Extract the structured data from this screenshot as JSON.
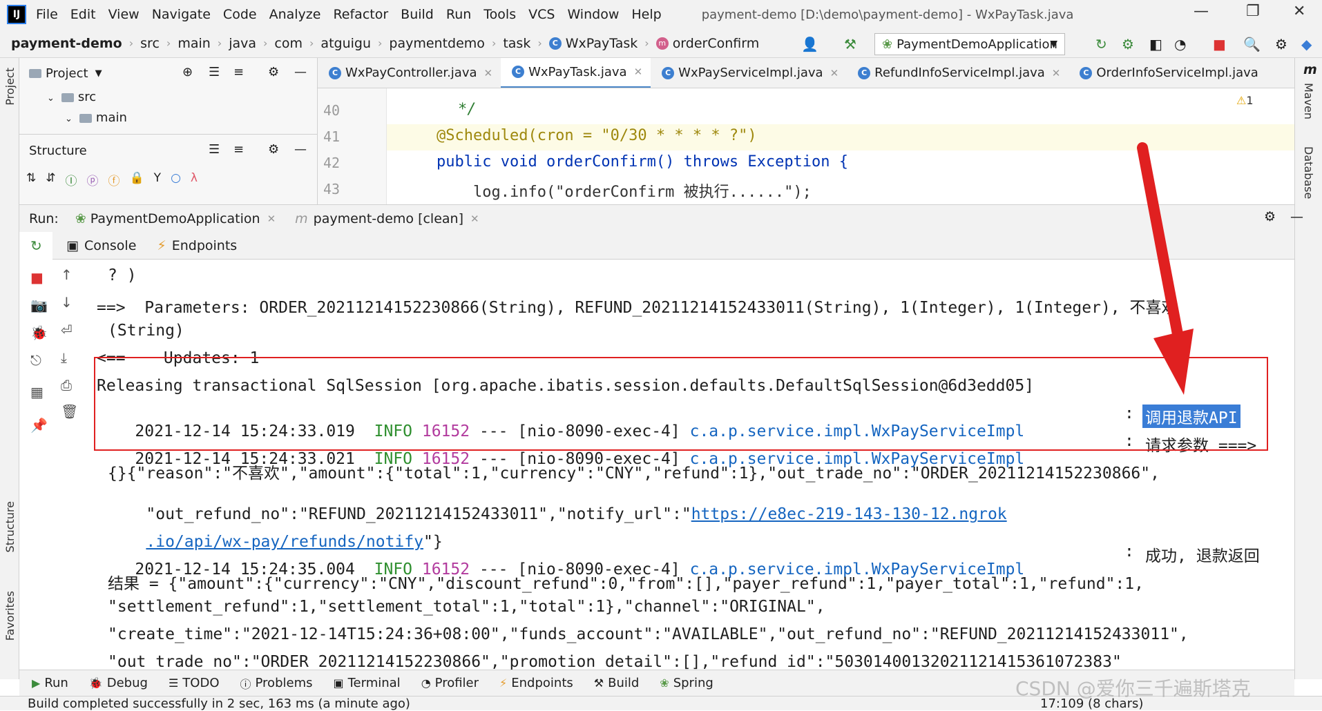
{
  "app": {
    "logo": "IJ",
    "window_title": "payment-demo [D:\\demo\\payment-demo] - WxPayTask.java"
  },
  "menu": [
    "File",
    "Edit",
    "View",
    "Navigate",
    "Code",
    "Analyze",
    "Refactor",
    "Build",
    "Run",
    "Tools",
    "VCS",
    "Window",
    "Help"
  ],
  "breadcrumb": {
    "project": "payment-demo",
    "items": [
      "src",
      "main",
      "java",
      "com",
      "atguigu",
      "paymentdemo",
      "task"
    ],
    "class": "WxPayTask",
    "method": "orderConfirm"
  },
  "run_config": "PaymentDemoApplication",
  "project_panel": {
    "title": "Project",
    "tree": [
      "src",
      "main"
    ]
  },
  "structure_panel": {
    "title": "Structure"
  },
  "left_strip": {
    "project": "Project",
    "structure": "Structure",
    "favorites": "Favorites"
  },
  "right_strip": {
    "maven": "Maven",
    "database": "Database",
    "m_icon": "m"
  },
  "editor_tabs": [
    "WxPayController.java",
    "WxPayTask.java",
    "WxPayServiceImpl.java",
    "RefundInfoServiceImpl.java",
    "OrderInfoServiceImpl.java"
  ],
  "active_tab": "WxPayTask.java",
  "warning_count": "1",
  "editor": {
    "lines": [
      {
        "n": "40",
        "text": "    */"
      },
      {
        "n": "41",
        "text": "@Scheduled(cron = \"0/30 * * * * ?\")"
      },
      {
        "n": "42",
        "text": "public void orderConfirm() throws Exception {"
      },
      {
        "n": "43",
        "text": "    log.info(\"orderConfirm 被执行......\");"
      }
    ]
  },
  "run_panel": {
    "label": "Run:",
    "tab1": "PaymentDemoApplication",
    "tab2": "payment-demo [clean]",
    "console_tab": "Console",
    "endpoints_tab": "Endpoints"
  },
  "console": {
    "l1": "? )",
    "l2": "==>  Parameters: ORDER_20211214152230866(String), REFUND_20211214152433011(String), 1(Integer), 1(Integer), 不喜欢",
    "l3": "(String)",
    "l4": "<==    Updates: 1",
    "l5": "Releasing transactional SqlSession [org.apache.ibatis.session.defaults.DefaultSqlSession@6d3edd05]",
    "log1": {
      "time": "2021-12-14 15:24:33.019",
      "level": "INFO",
      "pid": "16152",
      "thread": "--- [nio-8090-exec-4]",
      "cls": "c.a.p.service.impl.WxPayServiceImpl",
      "sep": ":",
      "msg": "调用退款API"
    },
    "log2": {
      "time": "2021-12-14 15:24:33.021",
      "level": "INFO",
      "pid": "16152",
      "thread": "--- [nio-8090-exec-4]",
      "cls": "c.a.p.service.impl.WxPayServiceImpl",
      "sep": ":",
      "msg": "请求参数 ===>"
    },
    "l8": "{}{\"reason\":\"不喜欢\",\"amount\":{\"total\":1,\"currency\":\"CNY\",\"refund\":1},\"out_trade_no\":\"ORDER_20211214152230866\",",
    "l9a": "\"out_refund_no\":\"REFUND_20211214152433011\",\"notify_url\":\"",
    "l9link": "https://e8ec-219-143-130-12.ngrok",
    "l10link": ".io/api/wx-pay/refunds/notify",
    "l10b": "\"}",
    "log3": {
      "time": "2021-12-14 15:24:35.004",
      "level": "INFO",
      "pid": "16152",
      "thread": "--- [nio-8090-exec-4]",
      "cls": "c.a.p.service.impl.WxPayServiceImpl",
      "sep": ":",
      "msg": "成功, 退款返回"
    },
    "l12": "结果 = {\"amount\":{\"currency\":\"CNY\",\"discount_refund\":0,\"from\":[],\"payer_refund\":1,\"payer_total\":1,\"refund\":1,",
    "l13": "\"settlement_refund\":1,\"settlement_total\":1,\"total\":1},\"channel\":\"ORIGINAL\",",
    "l14": "\"create_time\":\"2021-12-14T15:24:36+08:00\",\"funds_account\":\"AVAILABLE\",\"out_refund_no\":\"REFUND_20211214152433011\",",
    "l15": "\"out_trade_no\":\"ORDER_20211214152230866\",\"promotion_detail\":[],\"refund_id\":\"50301400132021121415361072383\""
  },
  "bottom_tabs": [
    "Run",
    "Debug",
    "TODO",
    "Problems",
    "Terminal",
    "Profiler",
    "Endpoints",
    "Build",
    "Spring"
  ],
  "status": {
    "message": "Build completed successfully in 2 sec, 163 ms (a minute ago)",
    "position": "17:109 (8 chars)"
  },
  "watermark": "CSDN @爱你三千遍斯塔克",
  "colors": {
    "accent": "#4a86c8",
    "annotation_red": "#e02020",
    "info_green": "#2f8f2f",
    "class_blue": "#1565c0",
    "selection": "#3a7dd6"
  }
}
